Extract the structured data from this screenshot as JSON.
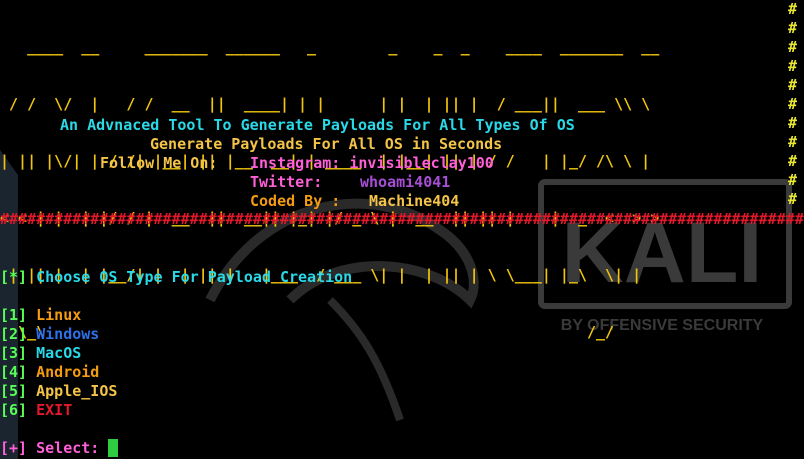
{
  "banner_art": [
    "   ____  __     _______  ______   _        _    _  _    ____  _______  __",
    " / /  \\/  |   / /  __  ||  ____| | |      | |  | || |  / ___||  ___ \\\\ \\",
    "| || |\\/| | / /| |__| || |__  __| | ____  | |__| || | / /   | |_/ /\\ \\ |",
    "< < | |  | |/ / |  __  ||  __|| |_| |/ _ \\ |  __  || || |    |  _  <  > >",
    " | || |  | |__/| |  | || |   |___  / ___ \\| |  | || | \\ \\___| |_\\  \\| |",
    "  \\_\\                                                            /_/"
  ],
  "tagline": "An Advnaced Tool To Generate Payloads For All Types Of OS",
  "subtagline": "Generate Payloads For All OS in Seconds",
  "follow": {
    "label": "Follow Me On:",
    "instagram": "Instagram: invisibleclay100",
    "twitter_label": "Twitter:",
    "twitter_handle": "whoami4041",
    "coded_label": "Coded By :",
    "coded_name": "Machine404"
  },
  "separator": "###############################################################################################",
  "hash_char": "#",
  "prompt_header": {
    "marker": "[*]",
    "text": "Choose OS Type For Payload Creation"
  },
  "options": [
    {
      "num": "[1]",
      "label": "Linux"
    },
    {
      "num": "[2]",
      "label": "Windows"
    },
    {
      "num": "[3]",
      "label": "MacOS"
    },
    {
      "num": "[4]",
      "label": "Android"
    },
    {
      "num": "[5]",
      "label": "Apple_IOS"
    },
    {
      "num": "[6]",
      "label": "EXIT"
    }
  ],
  "select": {
    "marker": "[+]",
    "text": "Select:"
  },
  "background": {
    "brand": "KALI",
    "tagline": "BY OFFENSIVE SECURITY"
  },
  "colors": {
    "background": "#000000",
    "banner": "#f1c40f",
    "cyan": "#29d9e8",
    "magenta": "#ff5fd7",
    "separator": "#e3182b"
  }
}
